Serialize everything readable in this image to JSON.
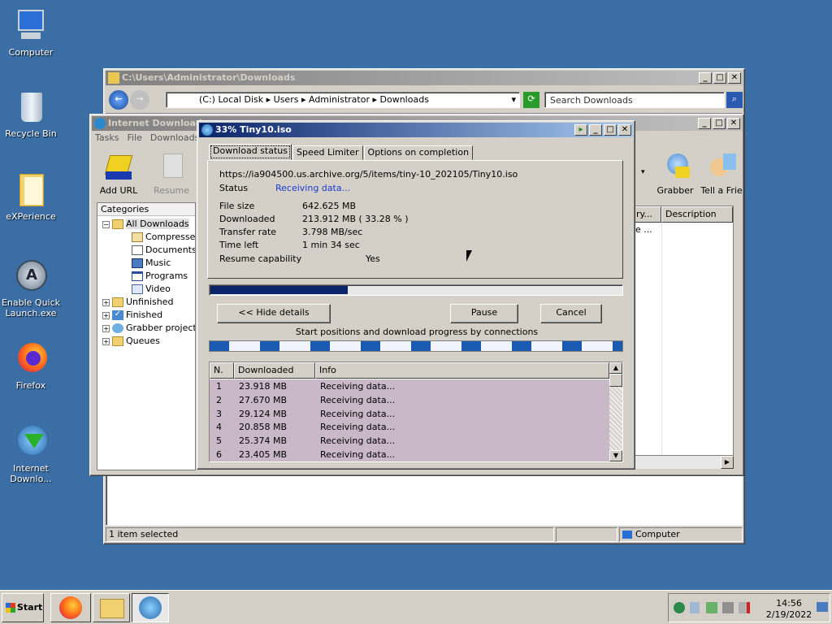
{
  "desktop": {
    "icons": [
      {
        "label": "Computer"
      },
      {
        "label": "Recycle Bin"
      },
      {
        "label": "eXPerience"
      },
      {
        "label": "Enable Quick Launch.exe"
      },
      {
        "label": "Firefox"
      },
      {
        "label": "Internet Downlo..."
      }
    ]
  },
  "explorer": {
    "title": "C:\\Users\\Administrator\\Downloads",
    "crumbs": [
      "(C:) Local Disk",
      "Users",
      "Administrator",
      "Downloads"
    ],
    "search_placeholder": "Search Downloads",
    "status_left": "1 item selected",
    "status_right": "Computer"
  },
  "idm": {
    "title": "Internet Download",
    "menu": [
      "Tasks",
      "File",
      "Downloads"
    ],
    "tools": {
      "add_url": "Add URL",
      "resume": "Resume",
      "grabber": "Grabber",
      "tell": "Tell a Frie"
    },
    "categories_header": "Categories",
    "tree": {
      "all": "All Downloads",
      "compressed": "Compressec",
      "documents": "Documents",
      "music": "Music",
      "programs": "Programs",
      "video": "Video",
      "unfinished": "Unfinished",
      "finished": "Finished",
      "grabber": "Grabber project",
      "queues": "Queues"
    },
    "cols": {
      "category": "ry...",
      "description": "Description"
    },
    "row_cell": "e ..."
  },
  "dialog": {
    "title": "33% Tiny10.iso",
    "tabs": [
      "Download status",
      "Speed Limiter",
      "Options on completion"
    ],
    "url": "https://ia904500.us.archive.org/5/items/tiny-10_202105/Tiny10.iso",
    "status_label": "Status",
    "status_value": "Receiving data...",
    "file_size_label": "File size",
    "file_size": "642.625  MB",
    "downloaded_label": "Downloaded",
    "downloaded": "213.912  MB  ( 33.28 % )",
    "rate_label": "Transfer rate",
    "rate": "3.798  MB/sec",
    "time_label": "Time left",
    "time": "1 min 34 sec",
    "resume_label": "Resume capability",
    "resume": "Yes",
    "progress": 0.3328,
    "hide_details": "<< Hide details",
    "pause": "Pause",
    "cancel": "Cancel",
    "connections_caption": "Start positions and download progress by connections",
    "grid_headers": [
      "N.",
      "Downloaded",
      "Info"
    ],
    "rows": [
      {
        "n": "1",
        "downloaded": "23.918  MB",
        "info": "Receiving data..."
      },
      {
        "n": "2",
        "downloaded": "27.670  MB",
        "info": "Receiving data..."
      },
      {
        "n": "3",
        "downloaded": "29.124  MB",
        "info": "Receiving data..."
      },
      {
        "n": "4",
        "downloaded": "20.858  MB",
        "info": "Receiving data..."
      },
      {
        "n": "5",
        "downloaded": "25.374  MB",
        "info": "Receiving data..."
      },
      {
        "n": "6",
        "downloaded": "23.405  MB",
        "info": "Receiving data..."
      }
    ]
  },
  "taskbar": {
    "start": "Start",
    "time": "14:56",
    "date": "2/19/2022"
  }
}
